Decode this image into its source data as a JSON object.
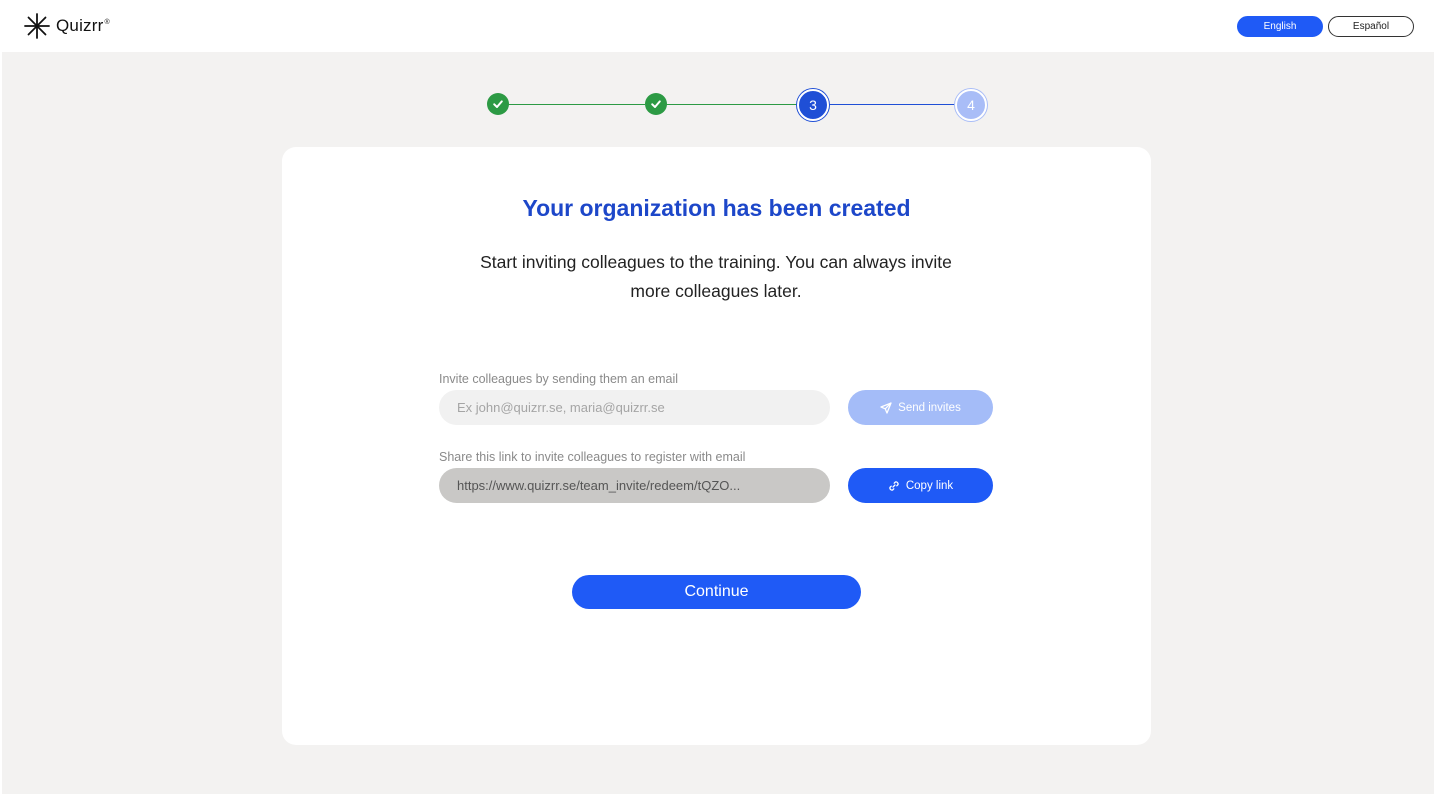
{
  "header": {
    "brand": "Quizrr",
    "brand_mark": "®",
    "languages": [
      {
        "label": "English",
        "selected": true
      },
      {
        "label": "Español",
        "selected": false
      }
    ]
  },
  "stepper": {
    "current_step": 3,
    "steps": [
      {
        "label": "",
        "state": "done",
        "icon": "check-icon"
      },
      {
        "label": "",
        "state": "done",
        "icon": "check-icon"
      },
      {
        "label": "3",
        "state": "current"
      },
      {
        "label": "4",
        "state": "upcoming"
      }
    ]
  },
  "card": {
    "title": "Your organization has been created",
    "subtitle": "Start inviting colleagues to the training. You can always invite more colleagues later.",
    "email_invite": {
      "label": "Invite colleagues by sending them an email",
      "placeholder": "Ex john@quizrr.se, maria@quizrr.se",
      "value": "",
      "button_label": "Send invites",
      "button_icon": "send-icon"
    },
    "link_invite": {
      "label": "Share this link to invite colleagues to register with email",
      "link": "https://www.quizrr.se/team_invite/redeem/tQZO...",
      "button_label": "Copy link",
      "button_icon": "link-icon"
    },
    "continue_label": "Continue"
  },
  "colors": {
    "primary": "#1f5af6",
    "primary_disabled": "#a4bcf8",
    "title": "#1d47c9",
    "success": "#2c9a44",
    "background": "#f3f2f1"
  }
}
